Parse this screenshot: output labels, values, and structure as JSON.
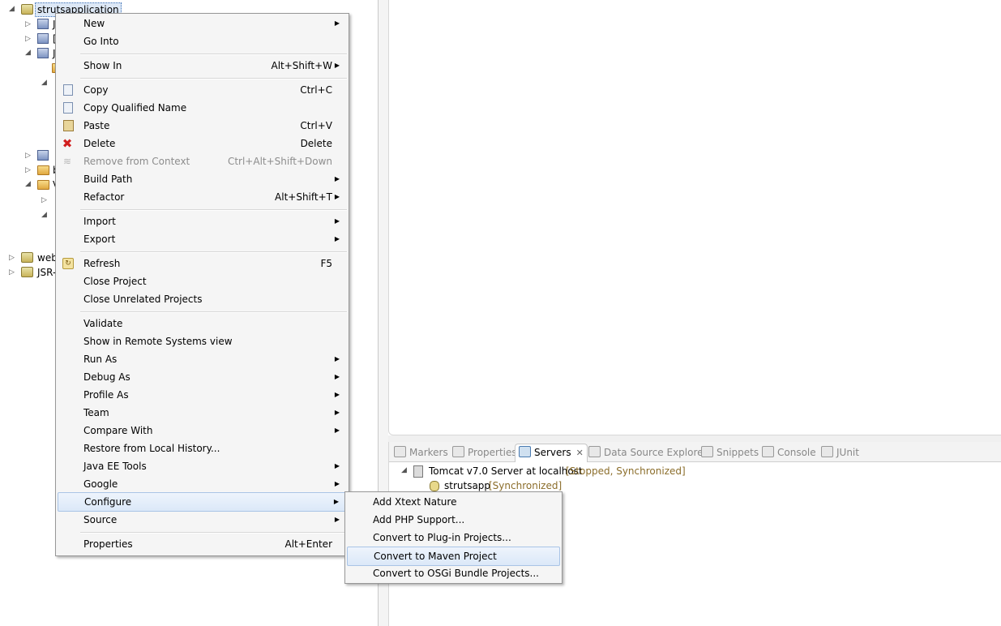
{
  "explorer": {
    "project_name": "strutsapplication",
    "rows": {
      "java_resources": "J",
      "jre_library": "[",
      "javascript": "J",
      "build": "b",
      "webcontent": "V",
      "web_project": "web",
      "jsr_project": "JSR-"
    }
  },
  "context_menu": {
    "items": [
      {
        "label": "New",
        "shortcut": "",
        "submenu": true
      },
      {
        "label": "Go Into",
        "shortcut": "",
        "submenu": false
      },
      {
        "label": "Show In",
        "shortcut": "Alt+Shift+W",
        "submenu": true
      },
      {
        "label": "Copy",
        "shortcut": "Ctrl+C",
        "submenu": false
      },
      {
        "label": "Copy Qualified Name",
        "shortcut": "",
        "submenu": false
      },
      {
        "label": "Paste",
        "shortcut": "Ctrl+V",
        "submenu": false
      },
      {
        "label": "Delete",
        "shortcut": "Delete",
        "submenu": false
      },
      {
        "label": "Remove from Context",
        "shortcut": "Ctrl+Alt+Shift+Down",
        "submenu": false,
        "disabled": true
      },
      {
        "label": "Build Path",
        "shortcut": "",
        "submenu": true
      },
      {
        "label": "Refactor",
        "shortcut": "Alt+Shift+T",
        "submenu": true
      },
      {
        "label": "Import",
        "shortcut": "",
        "submenu": true
      },
      {
        "label": "Export",
        "shortcut": "",
        "submenu": true
      },
      {
        "label": "Refresh",
        "shortcut": "F5",
        "submenu": false
      },
      {
        "label": "Close Project",
        "shortcut": "",
        "submenu": false
      },
      {
        "label": "Close Unrelated Projects",
        "shortcut": "",
        "submenu": false
      },
      {
        "label": "Validate",
        "shortcut": "",
        "submenu": false
      },
      {
        "label": "Show in Remote Systems view",
        "shortcut": "",
        "submenu": false
      },
      {
        "label": "Run As",
        "shortcut": "",
        "submenu": true
      },
      {
        "label": "Debug As",
        "shortcut": "",
        "submenu": true
      },
      {
        "label": "Profile As",
        "shortcut": "",
        "submenu": true
      },
      {
        "label": "Team",
        "shortcut": "",
        "submenu": true
      },
      {
        "label": "Compare With",
        "shortcut": "",
        "submenu": true
      },
      {
        "label": "Restore from Local History...",
        "shortcut": "",
        "submenu": false
      },
      {
        "label": "Java EE Tools",
        "shortcut": "",
        "submenu": true
      },
      {
        "label": "Google",
        "shortcut": "",
        "submenu": true
      },
      {
        "label": "Configure",
        "shortcut": "",
        "submenu": true,
        "highlighted": true
      },
      {
        "label": "Source",
        "shortcut": "",
        "submenu": true
      },
      {
        "label": "Properties",
        "shortcut": "Alt+Enter",
        "submenu": false
      }
    ],
    "submenu_arrow": "▶"
  },
  "configure_submenu": {
    "items": [
      {
        "label": "Add Xtext Nature"
      },
      {
        "label": "Add PHP Support..."
      },
      {
        "label": "Convert to Plug-in Projects..."
      },
      {
        "label": "Convert to Maven Project",
        "highlighted": true
      },
      {
        "label": "Convert to OSGi Bundle Projects..."
      }
    ]
  },
  "views": {
    "tabs": [
      {
        "label": "Markers",
        "icon": "markers-icon"
      },
      {
        "label": "Properties",
        "icon": "properties-icon"
      },
      {
        "label": "Servers",
        "icon": "servers-icon",
        "active": true
      },
      {
        "label": "Data Source Explorer",
        "icon": "data-source-icon"
      },
      {
        "label": "Snippets",
        "icon": "snippets-icon"
      },
      {
        "label": "Console",
        "icon": "console-icon"
      },
      {
        "label": "JUnit",
        "icon": "junit-icon"
      }
    ],
    "close_glyph": "✕",
    "server": {
      "name": "Tomcat v7.0 Server at localhost",
      "status": "[Stopped, Synchronized]",
      "module_name": "strutsapp",
      "module_status": "[Synchronized]"
    }
  }
}
